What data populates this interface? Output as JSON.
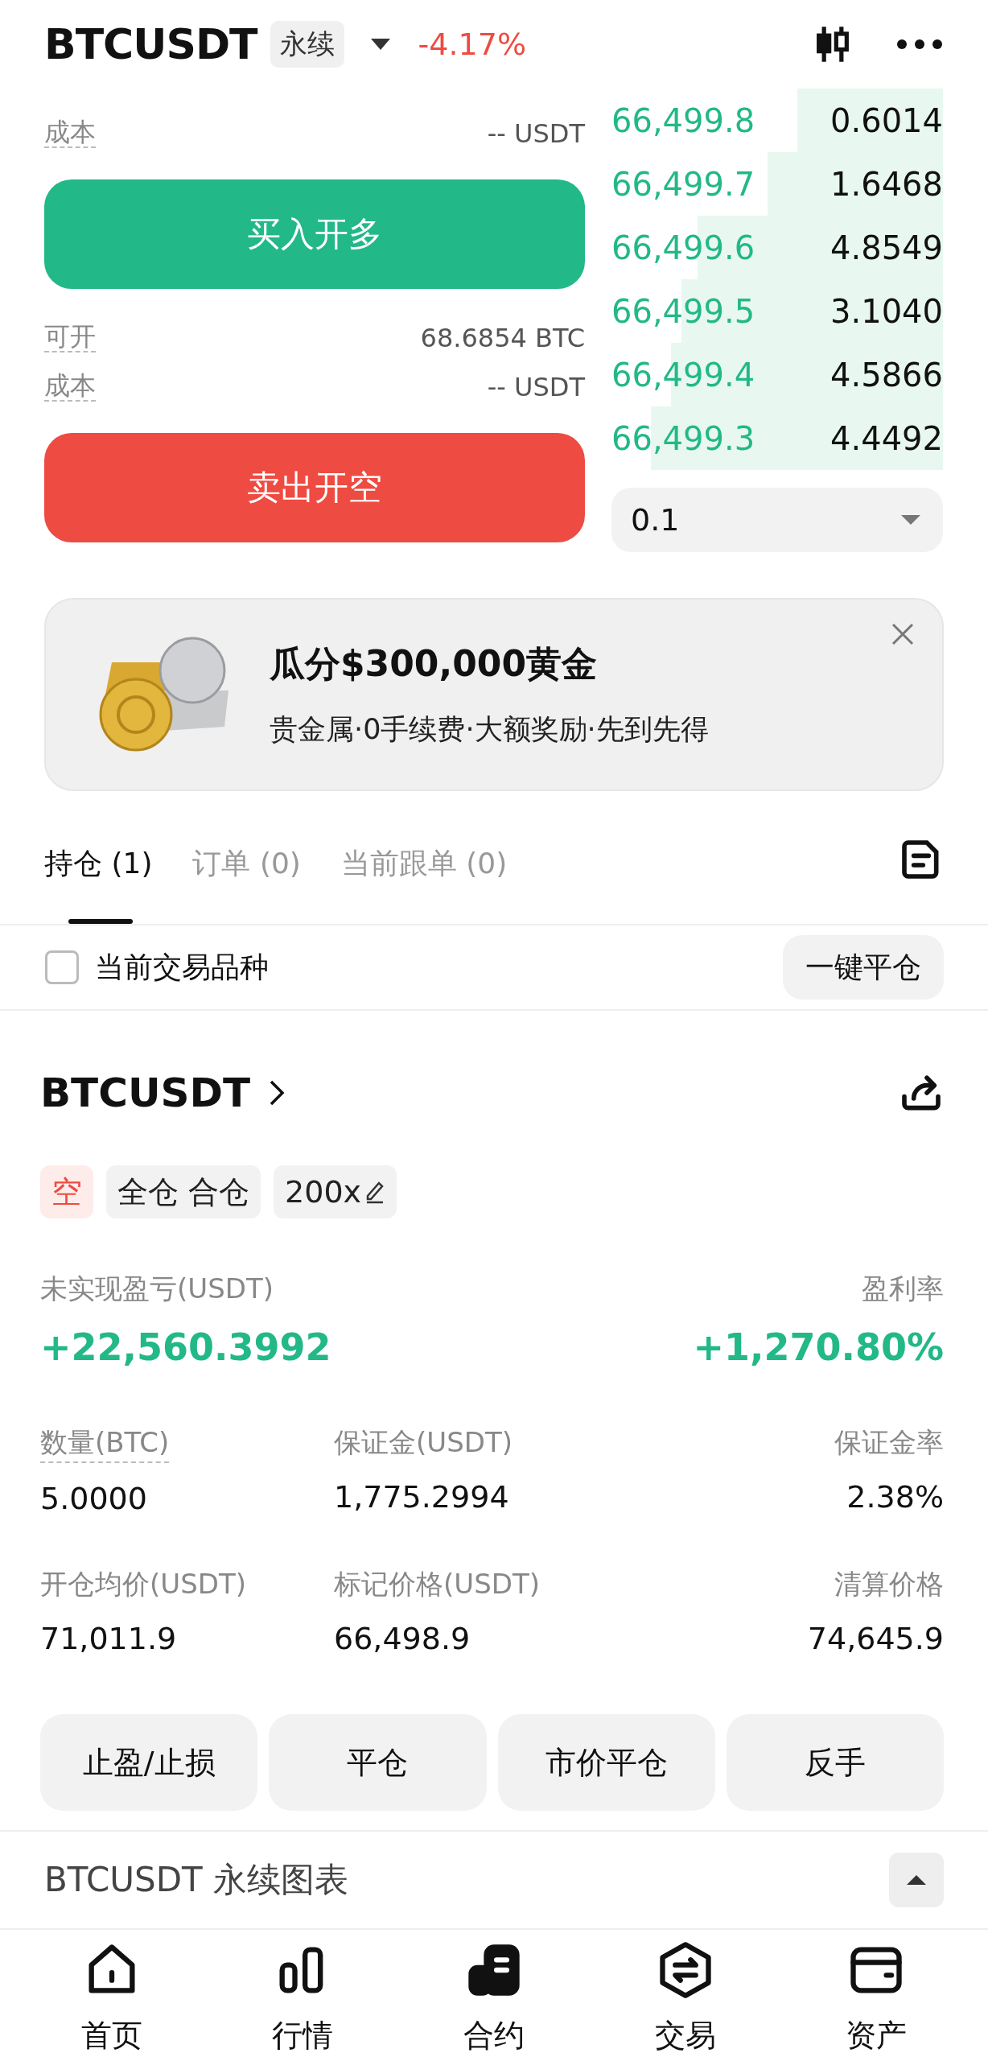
{
  "header": {
    "symbol": "BTCUSDT",
    "contract_type": "永续",
    "change": "-4.17%"
  },
  "open_long": {
    "rows": [
      {
        "label": "成本",
        "value": "-- USDT"
      }
    ],
    "button": "买入开多"
  },
  "open_short": {
    "rows": [
      {
        "label": "可开",
        "value": "68.6854 BTC"
      },
      {
        "label": "成本",
        "value": "-- USDT"
      }
    ],
    "button": "卖出开空"
  },
  "order_book": {
    "rows": [
      {
        "price": "66,499.8",
        "amount": "0.6014"
      },
      {
        "price": "66,499.7",
        "amount": "1.6468"
      },
      {
        "price": "66,499.6",
        "amount": "4.8549"
      },
      {
        "price": "66,499.5",
        "amount": "3.1040"
      },
      {
        "price": "66,499.4",
        "amount": "4.5866"
      },
      {
        "price": "66,499.3",
        "amount": "4.4492"
      }
    ],
    "precision": "0.1"
  },
  "promo": {
    "title": "瓜分$300,000黄金",
    "subtitle": "贵金属·0手续费·大额奖励·先到先得"
  },
  "tabs": [
    {
      "label": "持仓 (1)",
      "selected": true
    },
    {
      "label": "订单 (0)",
      "selected": false
    },
    {
      "label": "当前跟单 (0)",
      "selected": false
    }
  ],
  "filter": {
    "label": "当前交易品种",
    "checked": false,
    "close_all": "一键平仓"
  },
  "position": {
    "symbol": "BTCUSDT",
    "tags": [
      {
        "label": "空",
        "kind": "side"
      },
      {
        "label": "全仓 合仓",
        "kind": "mode"
      },
      {
        "label": "200x",
        "kind": "leverage"
      }
    ],
    "pnl_label": "未实现盈亏(USDT)",
    "pnl": "+22,560.3992",
    "roe_label": "盈利率",
    "roe": "+1,270.80%",
    "metrics": [
      {
        "label": "数量(BTC)",
        "value": "5.0000"
      },
      {
        "label": "保证金(USDT)",
        "value": "1,775.2994"
      },
      {
        "label": "保证金率",
        "value": "2.38%"
      },
      {
        "label": "开仓均价(USDT)",
        "value": "71,011.9"
      },
      {
        "label": "标记价格(USDT)",
        "value": "66,498.9"
      },
      {
        "label": "清算价格",
        "value": "74,645.9"
      }
    ],
    "actions": [
      "止盈/止损",
      "平仓",
      "市价平仓",
      "反手"
    ]
  },
  "chart_bar": {
    "title": "BTCUSDT 永续图表"
  },
  "nav": [
    {
      "label": "首页",
      "selected": false
    },
    {
      "label": "行情",
      "selected": false
    },
    {
      "label": "合约",
      "selected": true
    },
    {
      "label": "交易",
      "selected": false
    },
    {
      "label": "资产",
      "selected": false
    }
  ]
}
